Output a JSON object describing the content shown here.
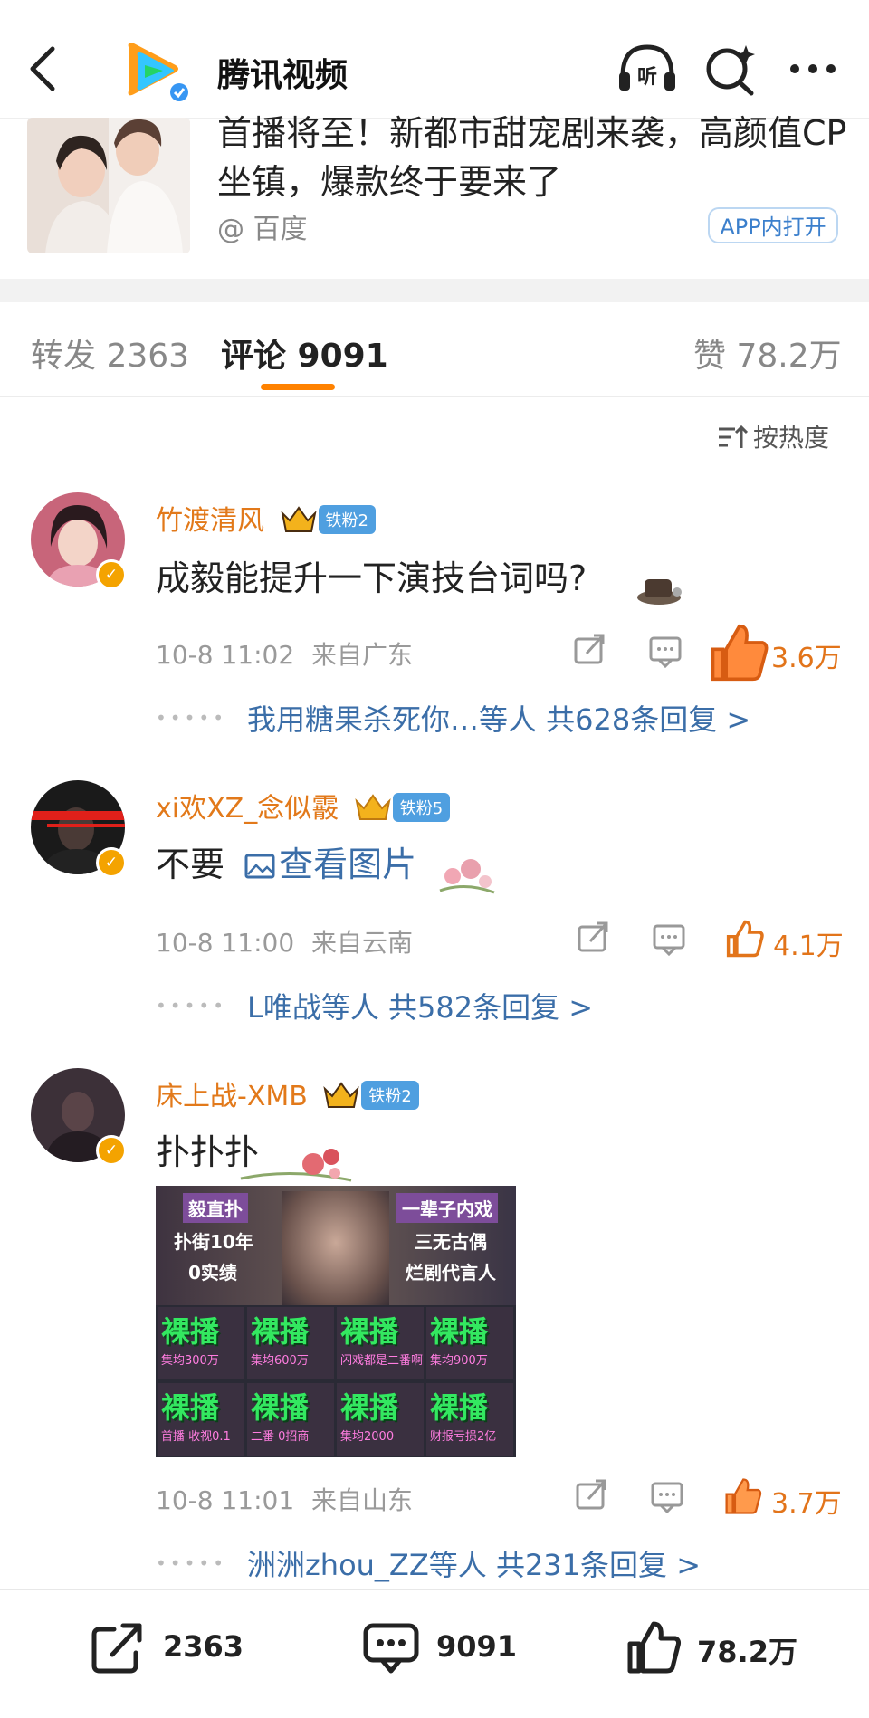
{
  "header": {
    "title": "腾讯视频",
    "icons": [
      "back-icon",
      "tencent-video-logo",
      "listen-icon",
      "search-ai-icon",
      "more-icon"
    ]
  },
  "article_card": {
    "title": "首播将至！新都市甜宠剧来袭，高颜值CP坐镇，爆款终于要来了",
    "source": "@ 百度",
    "open_button": "APP内打开"
  },
  "tabs": {
    "repost": "转发 2363",
    "comments": "评论 9091",
    "likes": "赞 78.2万"
  },
  "sort_label": "按热度",
  "comments": [
    {
      "username": "竹渡清风",
      "fan_badge": "铁粉2",
      "text": "成毅能提升一下演技台词吗?",
      "time": "10-8 11:02",
      "location": "来自广东",
      "likes": "3.6万",
      "replies": "我用糖果杀死你…等人  共628条回复 >"
    },
    {
      "username": "xi欢XZ_念似霰",
      "fan_badge": "铁粉5",
      "text": "不要",
      "image_link": "查看图片",
      "time": "10-8 11:00",
      "location": "来自云南",
      "likes": "4.1万",
      "replies": "L唯战等人  共582条回复 >"
    },
    {
      "username": "床上战-XMB",
      "fan_badge": "铁粉2",
      "text": "扑扑扑",
      "time": "10-8 11:01",
      "location": "来自山东",
      "likes": "3.7万",
      "replies": "洲洲zhou_ZZ等人  共231条回复 >",
      "meme": {
        "tag_left_1": "毅直扑",
        "tag_left_2": "扑街10年",
        "tag_left_3": "0实绩",
        "tag_right_1": "一辈子内戏",
        "tag_right_2": "三无古偶",
        "tag_right_3": "烂剧代言人",
        "cells": [
          {
            "big": "裸播",
            "small": "集均300万"
          },
          {
            "big": "裸播",
            "small": "集均600万"
          },
          {
            "big": "裸播",
            "small": "闪戏都是二番啊"
          },
          {
            "big": "裸播",
            "small": "集均900万"
          },
          {
            "big": "裸播",
            "small": "首播 收视0.1"
          },
          {
            "big": "裸播",
            "small": "二番 0招商"
          },
          {
            "big": "裸播",
            "small": "集均2000"
          },
          {
            "big": "裸播",
            "small": "财报亏损2亿"
          }
        ]
      }
    }
  ],
  "bottom_bar": {
    "repost_count": "2363",
    "comment_count": "9091",
    "like_count": "78.2万"
  },
  "colors": {
    "accent_orange": "#ff8200",
    "username_orange": "#e2791a",
    "link_blue": "#3b6ea8",
    "fan_badge_blue": "#4f9fe0"
  }
}
